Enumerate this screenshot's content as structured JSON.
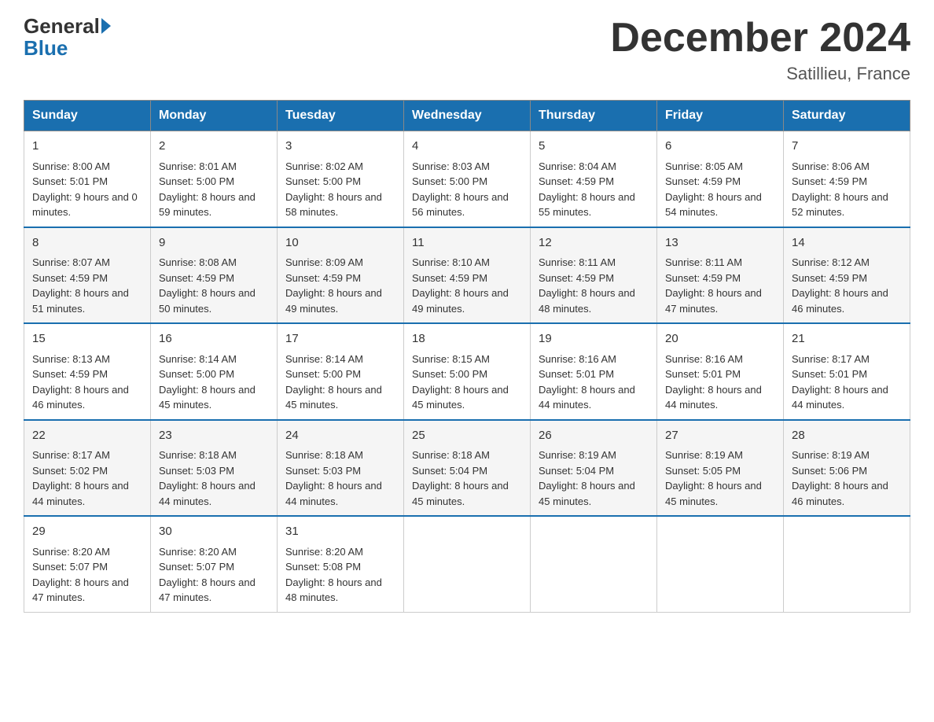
{
  "header": {
    "logo_general": "General",
    "logo_blue": "Blue",
    "month_title": "December 2024",
    "location": "Satillieu, France"
  },
  "days_of_week": [
    "Sunday",
    "Monday",
    "Tuesday",
    "Wednesday",
    "Thursday",
    "Friday",
    "Saturday"
  ],
  "weeks": [
    [
      {
        "day": "1",
        "sunrise": "8:00 AM",
        "sunset": "5:01 PM",
        "daylight": "9 hours and 0 minutes."
      },
      {
        "day": "2",
        "sunrise": "8:01 AM",
        "sunset": "5:00 PM",
        "daylight": "8 hours and 59 minutes."
      },
      {
        "day": "3",
        "sunrise": "8:02 AM",
        "sunset": "5:00 PM",
        "daylight": "8 hours and 58 minutes."
      },
      {
        "day": "4",
        "sunrise": "8:03 AM",
        "sunset": "5:00 PM",
        "daylight": "8 hours and 56 minutes."
      },
      {
        "day": "5",
        "sunrise": "8:04 AM",
        "sunset": "4:59 PM",
        "daylight": "8 hours and 55 minutes."
      },
      {
        "day": "6",
        "sunrise": "8:05 AM",
        "sunset": "4:59 PM",
        "daylight": "8 hours and 54 minutes."
      },
      {
        "day": "7",
        "sunrise": "8:06 AM",
        "sunset": "4:59 PM",
        "daylight": "8 hours and 52 minutes."
      }
    ],
    [
      {
        "day": "8",
        "sunrise": "8:07 AM",
        "sunset": "4:59 PM",
        "daylight": "8 hours and 51 minutes."
      },
      {
        "day": "9",
        "sunrise": "8:08 AM",
        "sunset": "4:59 PM",
        "daylight": "8 hours and 50 minutes."
      },
      {
        "day": "10",
        "sunrise": "8:09 AM",
        "sunset": "4:59 PM",
        "daylight": "8 hours and 49 minutes."
      },
      {
        "day": "11",
        "sunrise": "8:10 AM",
        "sunset": "4:59 PM",
        "daylight": "8 hours and 49 minutes."
      },
      {
        "day": "12",
        "sunrise": "8:11 AM",
        "sunset": "4:59 PM",
        "daylight": "8 hours and 48 minutes."
      },
      {
        "day": "13",
        "sunrise": "8:11 AM",
        "sunset": "4:59 PM",
        "daylight": "8 hours and 47 minutes."
      },
      {
        "day": "14",
        "sunrise": "8:12 AM",
        "sunset": "4:59 PM",
        "daylight": "8 hours and 46 minutes."
      }
    ],
    [
      {
        "day": "15",
        "sunrise": "8:13 AM",
        "sunset": "4:59 PM",
        "daylight": "8 hours and 46 minutes."
      },
      {
        "day": "16",
        "sunrise": "8:14 AM",
        "sunset": "5:00 PM",
        "daylight": "8 hours and 45 minutes."
      },
      {
        "day": "17",
        "sunrise": "8:14 AM",
        "sunset": "5:00 PM",
        "daylight": "8 hours and 45 minutes."
      },
      {
        "day": "18",
        "sunrise": "8:15 AM",
        "sunset": "5:00 PM",
        "daylight": "8 hours and 45 minutes."
      },
      {
        "day": "19",
        "sunrise": "8:16 AM",
        "sunset": "5:01 PM",
        "daylight": "8 hours and 44 minutes."
      },
      {
        "day": "20",
        "sunrise": "8:16 AM",
        "sunset": "5:01 PM",
        "daylight": "8 hours and 44 minutes."
      },
      {
        "day": "21",
        "sunrise": "8:17 AM",
        "sunset": "5:01 PM",
        "daylight": "8 hours and 44 minutes."
      }
    ],
    [
      {
        "day": "22",
        "sunrise": "8:17 AM",
        "sunset": "5:02 PM",
        "daylight": "8 hours and 44 minutes."
      },
      {
        "day": "23",
        "sunrise": "8:18 AM",
        "sunset": "5:03 PM",
        "daylight": "8 hours and 44 minutes."
      },
      {
        "day": "24",
        "sunrise": "8:18 AM",
        "sunset": "5:03 PM",
        "daylight": "8 hours and 44 minutes."
      },
      {
        "day": "25",
        "sunrise": "8:18 AM",
        "sunset": "5:04 PM",
        "daylight": "8 hours and 45 minutes."
      },
      {
        "day": "26",
        "sunrise": "8:19 AM",
        "sunset": "5:04 PM",
        "daylight": "8 hours and 45 minutes."
      },
      {
        "day": "27",
        "sunrise": "8:19 AM",
        "sunset": "5:05 PM",
        "daylight": "8 hours and 45 minutes."
      },
      {
        "day": "28",
        "sunrise": "8:19 AM",
        "sunset": "5:06 PM",
        "daylight": "8 hours and 46 minutes."
      }
    ],
    [
      {
        "day": "29",
        "sunrise": "8:20 AM",
        "sunset": "5:07 PM",
        "daylight": "8 hours and 47 minutes."
      },
      {
        "day": "30",
        "sunrise": "8:20 AM",
        "sunset": "5:07 PM",
        "daylight": "8 hours and 47 minutes."
      },
      {
        "day": "31",
        "sunrise": "8:20 AM",
        "sunset": "5:08 PM",
        "daylight": "8 hours and 48 minutes."
      },
      null,
      null,
      null,
      null
    ]
  ],
  "cell_labels": {
    "sunrise": "Sunrise:",
    "sunset": "Sunset:",
    "daylight": "Daylight:"
  }
}
